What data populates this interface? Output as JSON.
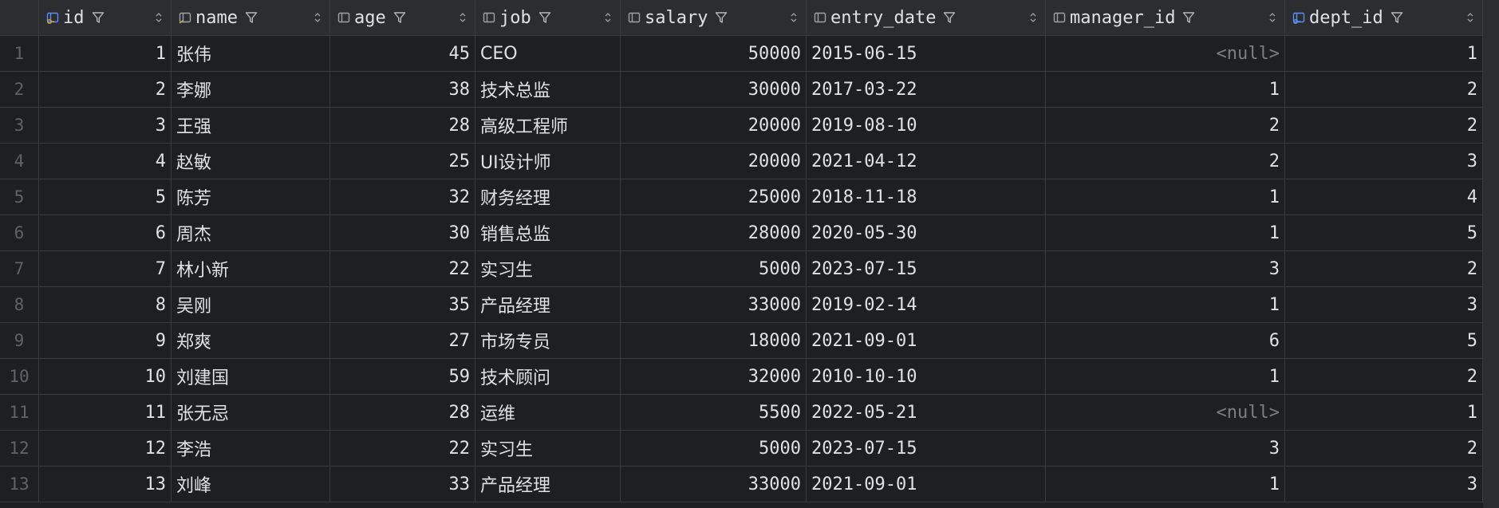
{
  "columns": [
    {
      "key": "id",
      "label": "id",
      "icon": "primary-key-icon"
    },
    {
      "key": "name",
      "label": "name",
      "icon": "index-column-icon"
    },
    {
      "key": "age",
      "label": "age",
      "icon": "column-icon"
    },
    {
      "key": "job",
      "label": "job",
      "icon": "column-icon"
    },
    {
      "key": "salary",
      "label": "salary",
      "icon": "column-icon"
    },
    {
      "key": "entry_date",
      "label": "entry_date",
      "icon": "column-icon"
    },
    {
      "key": "manager_id",
      "label": "manager_id",
      "icon": "column-icon"
    },
    {
      "key": "dept_id",
      "label": "dept_id",
      "icon": "foreign-key-icon"
    }
  ],
  "null_text": "<null>",
  "rows": [
    {
      "n": "1",
      "id": "1",
      "name": "张伟",
      "age": "45",
      "job": "CEO",
      "salary": "50000",
      "entry_date": "2015-06-15",
      "manager_id": "<null>",
      "dept_id": "1"
    },
    {
      "n": "2",
      "id": "2",
      "name": "李娜",
      "age": "38",
      "job": "技术总监",
      "salary": "30000",
      "entry_date": "2017-03-22",
      "manager_id": "1",
      "dept_id": "2"
    },
    {
      "n": "3",
      "id": "3",
      "name": "王强",
      "age": "28",
      "job": "高级工程师",
      "salary": "20000",
      "entry_date": "2019-08-10",
      "manager_id": "2",
      "dept_id": "2"
    },
    {
      "n": "4",
      "id": "4",
      "name": "赵敏",
      "age": "25",
      "job": "UI设计师",
      "salary": "20000",
      "entry_date": "2021-04-12",
      "manager_id": "2",
      "dept_id": "3"
    },
    {
      "n": "5",
      "id": "5",
      "name": "陈芳",
      "age": "32",
      "job": "财务经理",
      "salary": "25000",
      "entry_date": "2018-11-18",
      "manager_id": "1",
      "dept_id": "4"
    },
    {
      "n": "6",
      "id": "6",
      "name": "周杰",
      "age": "30",
      "job": "销售总监",
      "salary": "28000",
      "entry_date": "2020-05-30",
      "manager_id": "1",
      "dept_id": "5"
    },
    {
      "n": "7",
      "id": "7",
      "name": "林小新",
      "age": "22",
      "job": "实习生",
      "salary": "5000",
      "entry_date": "2023-07-15",
      "manager_id": "3",
      "dept_id": "2"
    },
    {
      "n": "8",
      "id": "8",
      "name": "吴刚",
      "age": "35",
      "job": "产品经理",
      "salary": "33000",
      "entry_date": "2019-02-14",
      "manager_id": "1",
      "dept_id": "3"
    },
    {
      "n": "9",
      "id": "9",
      "name": "郑爽",
      "age": "27",
      "job": "市场专员",
      "salary": "18000",
      "entry_date": "2021-09-01",
      "manager_id": "6",
      "dept_id": "5"
    },
    {
      "n": "10",
      "id": "10",
      "name": "刘建国",
      "age": "59",
      "job": "技术顾问",
      "salary": "32000",
      "entry_date": "2010-10-10",
      "manager_id": "1",
      "dept_id": "2"
    },
    {
      "n": "11",
      "id": "11",
      "name": "张无忌",
      "age": "28",
      "job": "运维",
      "salary": "5500",
      "entry_date": "2022-05-21",
      "manager_id": "<null>",
      "dept_id": "1"
    },
    {
      "n": "12",
      "id": "12",
      "name": "李浩",
      "age": "22",
      "job": "实习生",
      "salary": "5000",
      "entry_date": "2023-07-15",
      "manager_id": "3",
      "dept_id": "2"
    },
    {
      "n": "13",
      "id": "13",
      "name": "刘峰",
      "age": "33",
      "job": "产品经理",
      "salary": "33000",
      "entry_date": "2021-09-01",
      "manager_id": "1",
      "dept_id": "3"
    }
  ],
  "colors": {
    "background": "#1e1f22",
    "header": "#2b2d30",
    "grid_line": "#393b40",
    "text": "#dfe1e5",
    "row_number": "#5f6369",
    "null": "#7a7e85",
    "key_icon": "#c9a34a",
    "foreign_key_icon": "#5a8ef2"
  }
}
